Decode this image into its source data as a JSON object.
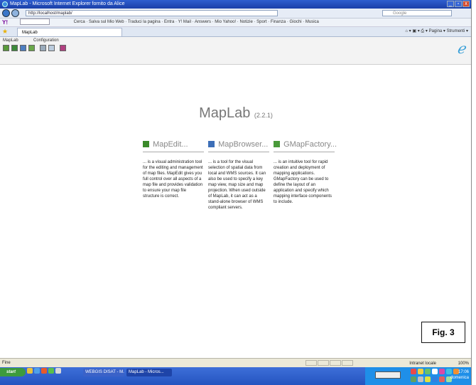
{
  "window": {
    "title": "MapLab - Microsoft Internet Explorer fornito da Alice",
    "controls": [
      "_",
      "▫",
      "x"
    ]
  },
  "address_bar": {
    "url": "http://localhost/maplab/",
    "search_placeholder": "Google"
  },
  "toolbar": {
    "logo": "Y!",
    "items": [
      "Cerca",
      "Salva sul Mio Web",
      "Traduci la pagina",
      "Entra",
      "Y! Mail",
      "Answers",
      "Mio Yahoo!",
      "Notizie",
      "Sport",
      "Finanza",
      "Giochi",
      "Musica"
    ]
  },
  "tab": {
    "label": "MapLab",
    "tools": [
      "Pagina",
      "Strumenti"
    ]
  },
  "app": {
    "menu": [
      "MapLab",
      "Configuration"
    ],
    "title": "MapLab",
    "version": "(2.2.1)",
    "tools": [
      {
        "name": "MapEdit...",
        "desc": "... is a visual administration tool for the editing and management of map files. MapEdit gives you full control over all aspects of a map file and provides validation to ensure your map file structure is correct.",
        "icon_color": "#3a8a2a"
      },
      {
        "name": "MapBrowser...",
        "desc": "... is a tool for the visual selection of spatial data from local and WMS sources. It can also be used to specify a key map view, map size and map projection. When used outside of MapLab, it can act as a stand-alone browser of WMS compliant servers.",
        "icon_color": "#3d6fb8"
      },
      {
        "name": "GMapFactory...",
        "desc": "... is an intuitive tool for rapid creation and deployment of mapping applications. GMapFactory can be used to define the layout of an application and specify which mapping interface components to include.",
        "icon_color": "#4a9a3a"
      }
    ]
  },
  "figure_label": "Fig. 3",
  "status": {
    "left": "Fine",
    "zone": "Intranet locale",
    "zoom": "100%"
  },
  "taskbar": {
    "start": "start",
    "buttons": [
      "WEBGIS DISAT - M...",
      "MapLab - Micros..."
    ],
    "clock": "17:06",
    "day": "domenica"
  },
  "colors": {
    "title_bar": "#1a3fa8",
    "taskbar": "#2454c0",
    "start": "#3d9b3d",
    "brand_logo": "#3aa0d8"
  }
}
